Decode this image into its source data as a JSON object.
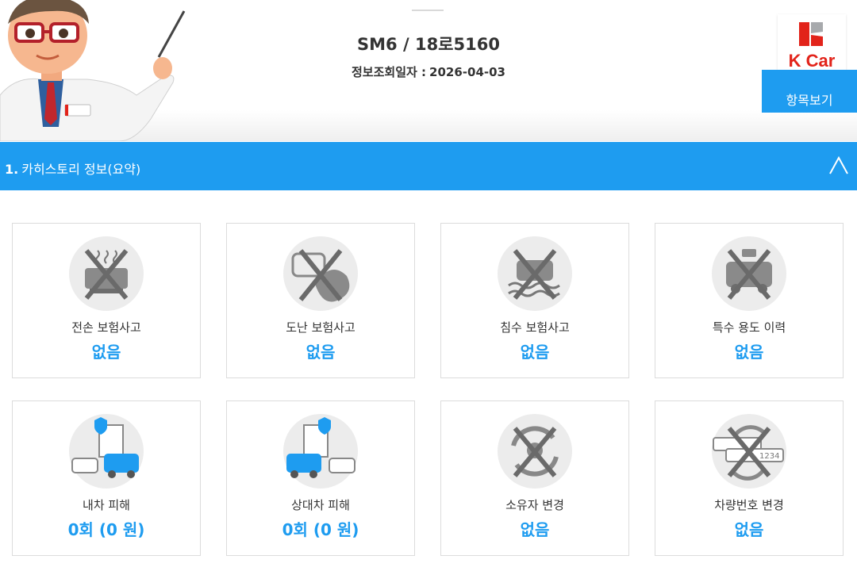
{
  "header": {
    "car_title": "SM6 / 18로5160",
    "query_date_label": "정보조회일자 :",
    "query_date": "2026-04-03",
    "mascot_badge": "CarHistory",
    "view_button": "항목보기",
    "brand": "K Car"
  },
  "section": {
    "number": "1.",
    "title": "카히스토리 정보(요약)"
  },
  "cards": [
    {
      "label": "전손 보험사고",
      "value": "없음",
      "icon": "total-loss-icon"
    },
    {
      "label": "도난 보험사고",
      "value": "없음",
      "icon": "theft-icon"
    },
    {
      "label": "침수 보험사고",
      "value": "없음",
      "icon": "flood-icon"
    },
    {
      "label": "특수 용도 이력",
      "value": "없음",
      "icon": "special-use-icon"
    },
    {
      "label": "내차 피해",
      "value": "0회 (0 원)",
      "icon": "my-car-damage-icon"
    },
    {
      "label": "상대차 피해",
      "value": "0회 (0 원)",
      "icon": "other-car-damage-icon"
    },
    {
      "label": "소유자 변경",
      "value": "없음",
      "icon": "owner-change-icon"
    },
    {
      "label": "차량번호 변경",
      "value": "없음",
      "icon": "plate-change-icon"
    }
  ],
  "plate_sample": "1234",
  "colors": {
    "accent": "#1e9cf0",
    "brand_red": "#e2231a",
    "icon_bg": "#ececec",
    "icon_gray": "#8a8a8a"
  }
}
